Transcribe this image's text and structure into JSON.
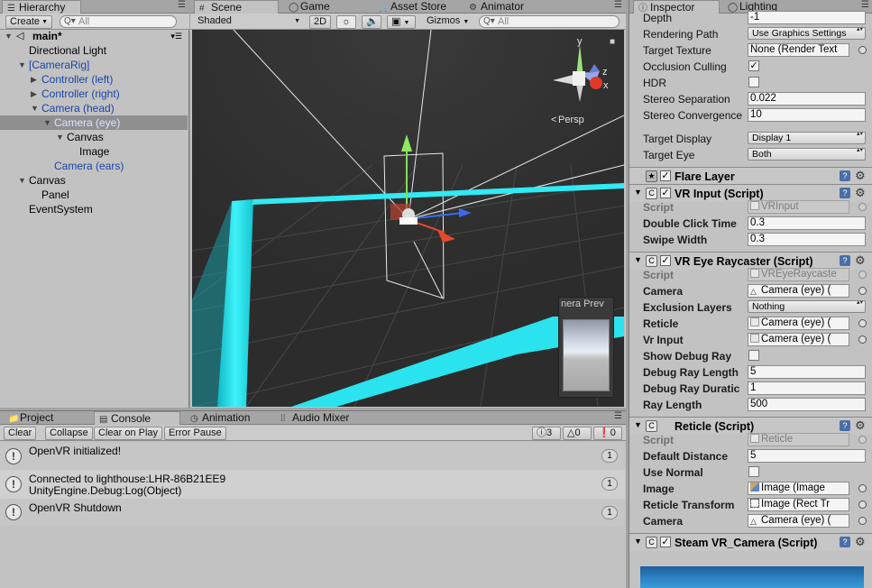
{
  "hierarchy": {
    "tab_label": "Hierarchy",
    "create_label": "Create",
    "search_placeholder": "All",
    "scene_name": "main*",
    "items": [
      {
        "label": "Directional Light"
      },
      {
        "label": "[CameraRig]"
      },
      {
        "label": "Controller (left)"
      },
      {
        "label": "Controller (right)"
      },
      {
        "label": "Camera (head)"
      },
      {
        "label": "Camera (eye)"
      },
      {
        "label": "Canvas"
      },
      {
        "label": "Image"
      },
      {
        "label": "Camera (ears)"
      },
      {
        "label": "Canvas"
      },
      {
        "label": "Panel"
      },
      {
        "label": "EventSystem"
      }
    ]
  },
  "scene": {
    "tabs": [
      {
        "label": "Scene"
      },
      {
        "label": "Game"
      },
      {
        "label": "Asset Store"
      },
      {
        "label": "Animator"
      }
    ],
    "shading_mode": "Shaded",
    "mode_2d": "2D",
    "gizmos_label": "Gizmos",
    "search_placeholder": "All",
    "persp_label": "Persp",
    "camera_preview_label": "nera Prev",
    "axis_x": "x",
    "axis_y": "y",
    "axis_z": "z"
  },
  "bottom": {
    "tabs": [
      {
        "label": "Project"
      },
      {
        "label": "Console"
      },
      {
        "label": "Animation"
      },
      {
        "label": "Audio Mixer"
      }
    ],
    "buttons": {
      "clear": "Clear",
      "collapse": "Collapse",
      "clear_on_play": "Clear on Play",
      "error_pause": "Error Pause"
    },
    "counts": {
      "info": "3",
      "warn": "0",
      "error": "0"
    },
    "logs": [
      {
        "line1": "OpenVR initialized!",
        "line2": "",
        "count": "1"
      },
      {
        "line1": "Connected to lighthouse:LHR-86B21EE9",
        "line2": "UnityEngine.Debug:Log(Object)",
        "count": "1"
      },
      {
        "line1": "OpenVR Shutdown",
        "line2": "",
        "count": "1"
      }
    ]
  },
  "inspector": {
    "tabs": [
      {
        "label": "Inspector"
      },
      {
        "label": "Lighting"
      }
    ],
    "camera": {
      "depth_label": "Depth",
      "depth_value": "-1",
      "rendering_path_label": "Rendering Path",
      "rendering_path_value": "Use Graphics Settings",
      "target_texture_label": "Target Texture",
      "target_texture_value": "None (Render Text",
      "occlusion_label": "Occlusion Culling",
      "occlusion_checked": true,
      "hdr_label": "HDR",
      "hdr_checked": false,
      "stereo_sep_label": "Stereo Separation",
      "stereo_sep_value": "0.022",
      "stereo_conv_label": "Stereo Convergence",
      "stereo_conv_value": "10",
      "target_display_label": "Target Display",
      "target_display_value": "Display 1",
      "target_eye_label": "Target Eye",
      "target_eye_value": "Both"
    },
    "flare_layer": {
      "title": "Flare Layer"
    },
    "vr_input": {
      "title": "VR Input (Script)",
      "script_label": "Script",
      "script_value": "VRInput",
      "double_click_label": "Double Click Time",
      "double_click_value": "0.3",
      "swipe_label": "Swipe Width",
      "swipe_value": "0.3"
    },
    "eye_raycaster": {
      "title": "VR Eye Raycaster (Script)",
      "script_label": "Script",
      "script_value": "VREyeRaycaste",
      "camera_label": "Camera",
      "camera_value": "Camera (eye) (",
      "exclusion_label": "Exclusion Layers",
      "exclusion_value": "Nothing",
      "reticle_label": "Reticle",
      "reticle_value": "Camera (eye) (",
      "vr_input_label": "Vr Input",
      "vr_input_value": "Camera (eye) (",
      "debug_ray_label": "Show Debug Ray",
      "debug_ray_checked": false,
      "debug_len_label": "Debug Ray Length",
      "debug_len_value": "5",
      "debug_dur_label": "Debug Ray Duratic",
      "debug_dur_value": "1",
      "ray_len_label": "Ray Length",
      "ray_len_value": "500"
    },
    "reticle": {
      "title": "Reticle (Script)",
      "script_label": "Script",
      "script_value": "Reticle",
      "default_dist_label": "Default Distance",
      "default_dist_value": "5",
      "use_normal_label": "Use Normal",
      "use_normal_checked": false,
      "image_label": "Image",
      "image_value": "Image (Image",
      "transform_label": "Reticle Transform",
      "transform_value": "Image (Rect Tr",
      "camera_label": "Camera",
      "camera_value": "Camera (eye) ("
    },
    "steam_camera": {
      "title": "Steam VR_Camera (Script)"
    }
  },
  "colors": {
    "scene_bg": "#2f2f2f",
    "cyan_glow": "#27e8f2",
    "selection": "#8f8f8f",
    "link_blue": "#1a44a8",
    "help_blue": "#4a6fa8"
  }
}
